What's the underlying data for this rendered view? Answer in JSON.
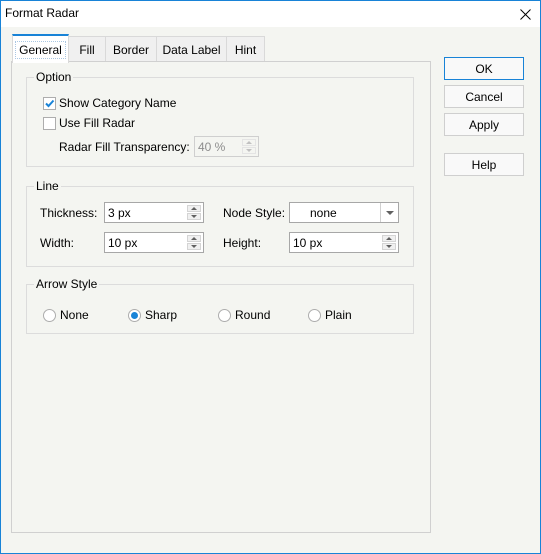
{
  "window": {
    "title": "Format Radar"
  },
  "tabs": [
    {
      "label": "General",
      "active": true
    },
    {
      "label": "Fill",
      "active": false
    },
    {
      "label": "Border",
      "active": false
    },
    {
      "label": "Data Label",
      "active": false
    },
    {
      "label": "Hint",
      "active": false
    }
  ],
  "option_group": {
    "legend": "Option",
    "show_category_name": {
      "label": "Show Category Name",
      "checked": true
    },
    "use_fill_radar": {
      "label": "Use Fill Radar",
      "checked": false
    },
    "radar_fill_transparency": {
      "label": "Radar Fill Transparency:",
      "value": "40 %",
      "enabled": false
    }
  },
  "line_group": {
    "legend": "Line",
    "thickness": {
      "label": "Thickness:",
      "value": "3 px"
    },
    "node_style": {
      "label": "Node Style:",
      "value": "none"
    },
    "width": {
      "label": "Width:",
      "value": "10 px"
    },
    "height": {
      "label": "Height:",
      "value": "10 px"
    }
  },
  "arrow_group": {
    "legend": "Arrow Style",
    "options": [
      {
        "label": "None",
        "checked": false
      },
      {
        "label": "Sharp",
        "checked": true
      },
      {
        "label": "Round",
        "checked": false
      },
      {
        "label": "Plain",
        "checked": false
      }
    ]
  },
  "buttons": {
    "ok": "OK",
    "cancel": "Cancel",
    "apply": "Apply",
    "help": "Help"
  },
  "colors": {
    "accent": "#1883d7",
    "background": "#f4f5f1"
  }
}
